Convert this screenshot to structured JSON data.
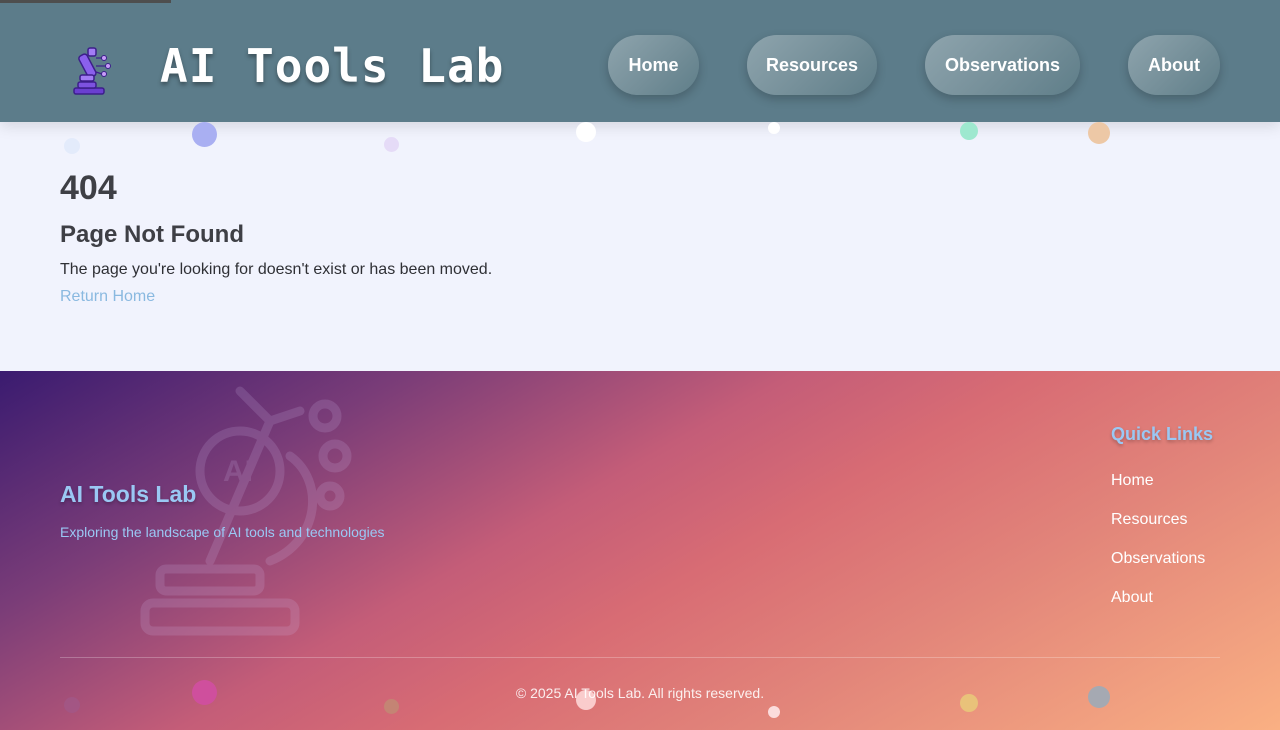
{
  "header": {
    "site_title": "AI Tools Lab",
    "logo_icon": "microscope-icon",
    "nav": [
      {
        "label": "Home"
      },
      {
        "label": "Resources"
      },
      {
        "label": "Observations"
      },
      {
        "label": "About"
      }
    ]
  },
  "error": {
    "code": "404",
    "title": "Page Not Found",
    "message": "The page you're looking for doesn't exist or has been moved.",
    "link_label": "Return Home"
  },
  "footer": {
    "title": "AI Tools Lab",
    "tagline": "Exploring the landscape of AI tools and technologies",
    "quick_links_title": "Quick Links",
    "quick_links": [
      {
        "label": "Home"
      },
      {
        "label": "Resources"
      },
      {
        "label": "Observations"
      },
      {
        "label": "About"
      }
    ],
    "copyright": "© 2025 AI Tools Lab. All rights reserved.",
    "watermark_icon": "microscope-ai-icon"
  },
  "colors": {
    "header_bg": "#5c7c8a",
    "page_bg": "#f1f3fd",
    "link": "#8ab9e0",
    "footer_heading": "#9ac8f4",
    "footer_gradient_start": "#3a1b70",
    "footer_gradient_end": "#fab083"
  }
}
